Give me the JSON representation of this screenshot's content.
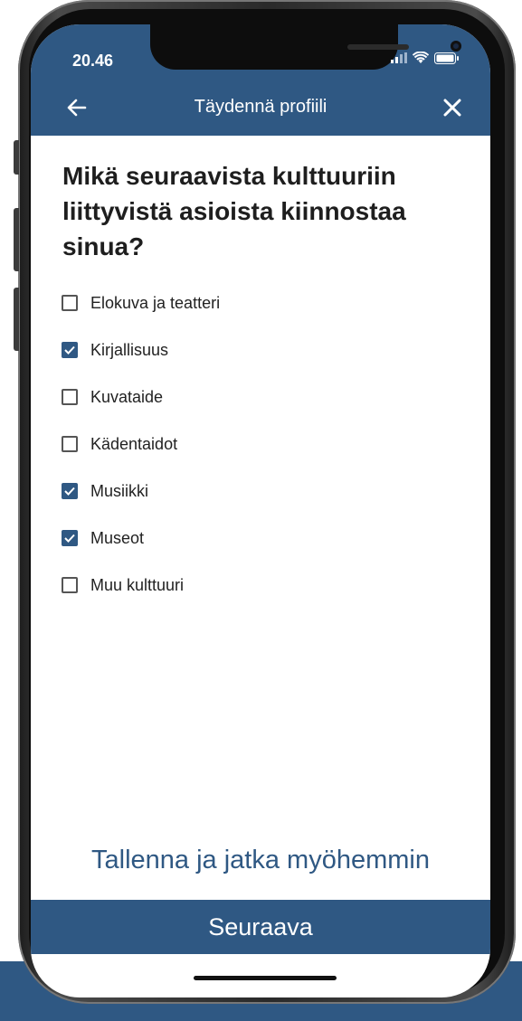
{
  "status_bar": {
    "time": "20.46"
  },
  "header": {
    "title": "Täydennä profiili",
    "back_icon": "arrow-left-icon",
    "close_icon": "close-icon"
  },
  "question": "Mikä seuraavista kulttuuriin liittyvistä asioista kiinnostaa sinua?",
  "options": [
    {
      "label": "Elokuva ja teatteri",
      "checked": false
    },
    {
      "label": "Kirjallisuus",
      "checked": true
    },
    {
      "label": "Kuvataide",
      "checked": false
    },
    {
      "label": "Kädentaidot",
      "checked": false
    },
    {
      "label": "Musiikki",
      "checked": true
    },
    {
      "label": "Museot",
      "checked": true
    },
    {
      "label": "Muu kulttuuri",
      "checked": false
    }
  ],
  "footer": {
    "save_later_label": "Tallenna ja jatka myöhemmin",
    "next_label": "Seuraava"
  },
  "colors": {
    "brand": "#2f5883",
    "text": "#1e1e1e",
    "background": "#ffffff"
  }
}
